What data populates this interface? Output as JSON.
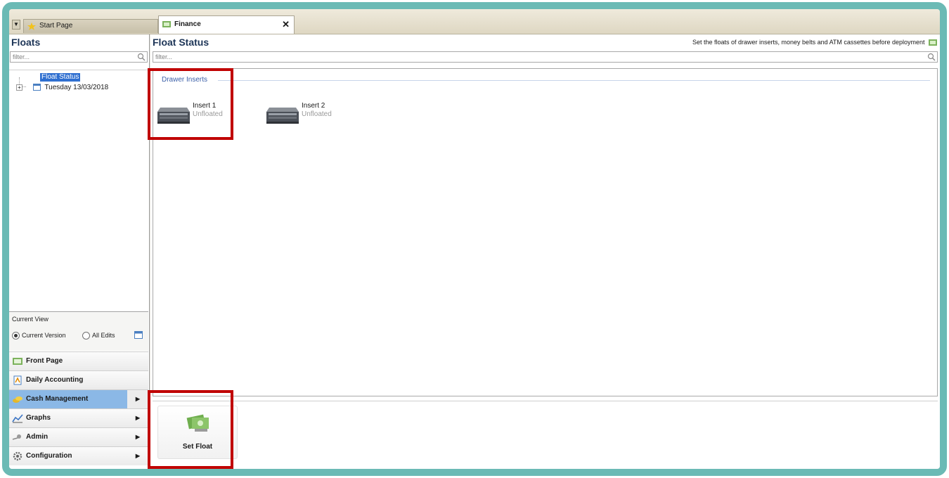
{
  "tabs": [
    {
      "label": "Start Page",
      "icon": "star-icon"
    },
    {
      "label": "Finance",
      "icon": "finance-icon",
      "close": "✕"
    }
  ],
  "left": {
    "title": "Floats",
    "filter_placeholder": "filter...",
    "tree": {
      "selected": "Float Status",
      "expander": "+",
      "day": "Tuesday 13/03/2018"
    },
    "current_view": {
      "label": "Current View",
      "options": [
        "Current Version",
        "All Edits"
      ],
      "selected": "Current Version"
    },
    "nav": [
      {
        "label": "Front Page",
        "icon": "front-page-icon",
        "arrow": false
      },
      {
        "label": "Daily Accounting",
        "icon": "daily-accounting-icon",
        "arrow": false
      },
      {
        "label": "Cash Management",
        "icon": "cash-management-icon",
        "arrow": true,
        "active": true
      },
      {
        "label": "Graphs",
        "icon": "graphs-icon",
        "arrow": true
      },
      {
        "label": "Admin",
        "icon": "admin-icon",
        "arrow": true
      },
      {
        "label": "Configuration",
        "icon": "configuration-icon",
        "arrow": true
      }
    ],
    "arrow_glyph": "▶"
  },
  "main": {
    "title": "Float Status",
    "description": "Set the floats of drawer inserts, money belts and ATM cassettes before deployment",
    "filter_placeholder": "filter...",
    "group": "Drawer Inserts",
    "inserts": [
      {
        "name": "Insert 1",
        "status": "Unfloated"
      },
      {
        "name": "Insert 2",
        "status": "Unfloated"
      }
    ],
    "action": {
      "label": "Set Float",
      "icon": "money-icon"
    }
  },
  "colors": {
    "frame": "#6bbab5",
    "highlight": "#c00000",
    "selection": "#2f6fd0",
    "active_nav": "#8bb8e6"
  }
}
